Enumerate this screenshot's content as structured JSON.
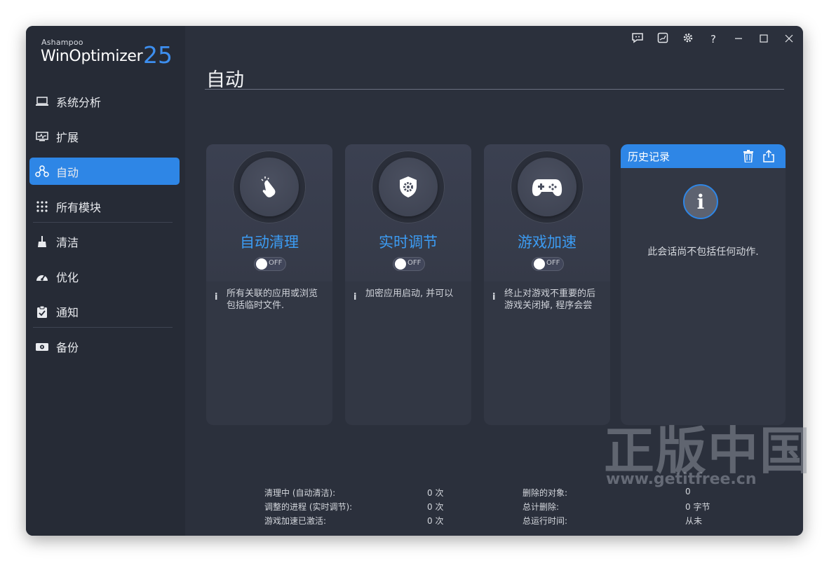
{
  "app": {
    "brand_small": "Ashampoo",
    "brand_name": "WinOptimizer",
    "brand_version": "25",
    "accent": "#2e86e6"
  },
  "sidebar": {
    "items": [
      {
        "label": "系统分析",
        "icon": "laptop-icon"
      },
      {
        "label": "扩展",
        "icon": "monitor-chart-icon"
      },
      {
        "label": "自动",
        "icon": "automation-icon",
        "active": true
      },
      {
        "label": "所有模块",
        "icon": "grid-icon"
      },
      {
        "label": "清洁",
        "icon": "broom-icon"
      },
      {
        "label": "优化",
        "icon": "speedometer-icon"
      },
      {
        "label": "通知",
        "icon": "clipboard-icon"
      },
      {
        "label": "备份",
        "icon": "backup-drive-icon"
      }
    ]
  },
  "titlebar": {
    "help": "?"
  },
  "page": {
    "title": "自动"
  },
  "cards": [
    {
      "title": "自动清理",
      "toggle": "OFF",
      "desc_line1": "所有关联的应用或浏览",
      "desc_line2": "包括临时文件."
    },
    {
      "title": "实时调节",
      "toggle": "OFF",
      "desc_line1": "加密应用启动, 并可以",
      "desc_line2": ""
    },
    {
      "title": "游戏加速",
      "toggle": "OFF",
      "desc_line1": "终止对游戏不重要的后",
      "desc_line2": "游戏关闭掉, 程序会尝"
    }
  ],
  "history": {
    "title": "历史记录",
    "info_glyph": "i",
    "empty_text": "此会话尚不包括任何动作."
  },
  "stats": {
    "left": [
      {
        "label": "清理中 (自动清洁):",
        "value": "0 次"
      },
      {
        "label": "调整的进程 (实时调节):",
        "value": "0 次"
      },
      {
        "label": "游戏加速已激活:",
        "value": "0 次"
      }
    ],
    "right": [
      {
        "label": "删除的对象:",
        "value": "0"
      },
      {
        "label": "总计删除:",
        "value": "0 字节"
      },
      {
        "label": "总运行时间:",
        "value": "从未"
      }
    ]
  },
  "watermark": {
    "big": "正版中国",
    "small": "www.getitfree.cn"
  }
}
